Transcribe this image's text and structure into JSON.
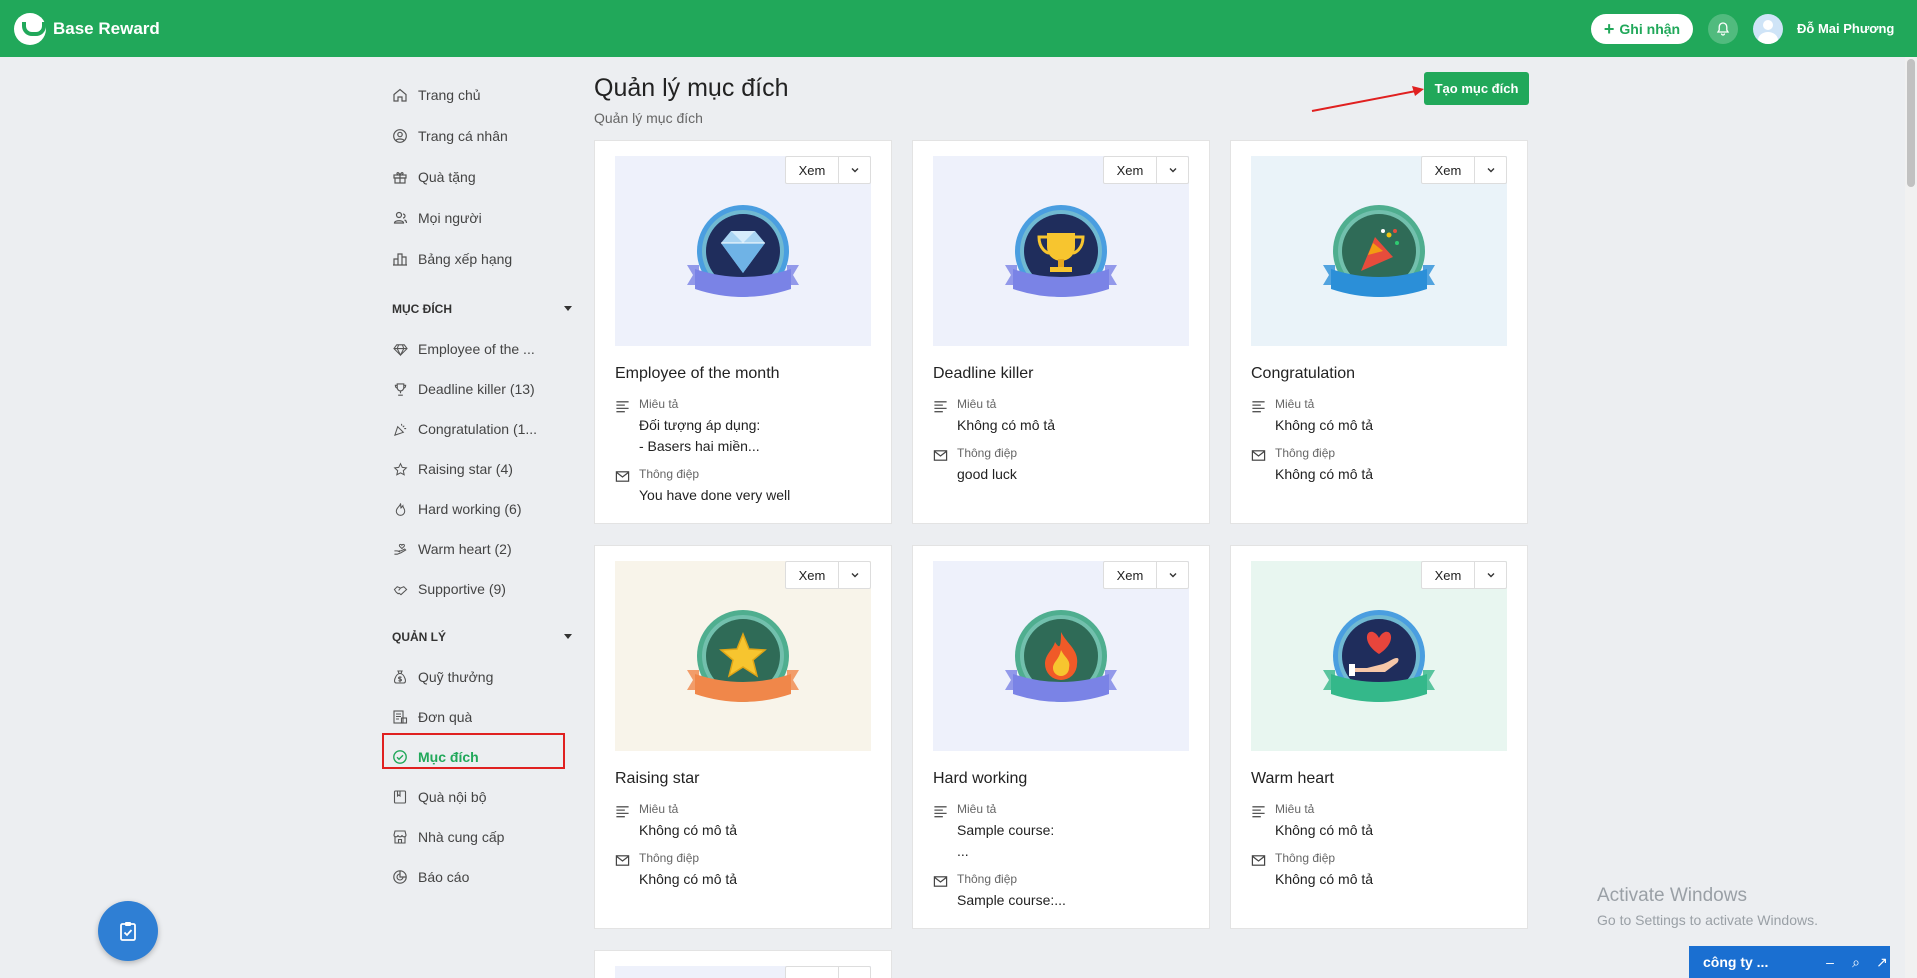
{
  "app": {
    "brand": "Base Reward",
    "record_button": "Ghi nhận",
    "user_name": "Đỗ Mai Phương",
    "accent": "#21a85a"
  },
  "sidebar": {
    "main": [
      {
        "label": "Trang chủ",
        "icon": "home-icon"
      },
      {
        "label": "Trang cá nhân",
        "icon": "profile-icon"
      },
      {
        "label": "Quà tặng",
        "icon": "gift-icon"
      },
      {
        "label": "Mọi người",
        "icon": "people-icon"
      },
      {
        "label": "Bảng xếp hạng",
        "icon": "leaderboard-icon"
      }
    ],
    "purpose_section": "MỤC ĐÍCH",
    "purposes": [
      {
        "label": "Employee of the ...",
        "icon": "diamond-icon"
      },
      {
        "label": "Deadline killer (13)",
        "icon": "trophy-icon"
      },
      {
        "label": "Congratulation (1...",
        "icon": "party-icon"
      },
      {
        "label": "Raising star (4)",
        "icon": "star-icon"
      },
      {
        "label": "Hard working (6)",
        "icon": "fire-icon"
      },
      {
        "label": "Warm heart (2)",
        "icon": "hand-heart-icon"
      },
      {
        "label": "Supportive (9)",
        "icon": "handshake-icon"
      }
    ],
    "manage_section": "QUẢN LÝ",
    "manage": [
      {
        "label": "Quỹ thưởng",
        "icon": "fund-icon"
      },
      {
        "label": "Đơn quà",
        "icon": "order-icon"
      },
      {
        "label": "Mục đích",
        "icon": "check-circle-icon",
        "active": true
      },
      {
        "label": "Quà nội bộ",
        "icon": "internal-gift-icon"
      },
      {
        "label": "Nhà cung cấp",
        "icon": "store-icon"
      },
      {
        "label": "Báo cáo",
        "icon": "report-icon"
      }
    ]
  },
  "page": {
    "title": "Quản lý mục đích",
    "subtitle": "Quản lý mục đích",
    "create_button": "Tạo mục đích"
  },
  "labels": {
    "view": "Xem",
    "description": "Miêu tả",
    "message": "Thông điệp"
  },
  "cards": [
    {
      "title": "Employee of the month",
      "desc": [
        "Đối tượng áp dụng:",
        "- Basers hai miền..."
      ],
      "message": "You have done very well",
      "badge": "diamond-icon",
      "bg": "#eef1fb",
      "ribbon": "#7a83e6"
    },
    {
      "title": "Deadline killer",
      "desc": [
        "Không có mô tả"
      ],
      "message": "good luck",
      "badge": "trophy-icon",
      "bg": "#eef1fb",
      "ribbon": "#7a83e6"
    },
    {
      "title": "Congratulation",
      "desc": [
        "Không có mô tả"
      ],
      "message": "Không có mô tả",
      "badge": "party-icon",
      "bg": "#eaf3f9",
      "ribbon": "#2b8fd8"
    },
    {
      "title": "Raising star",
      "desc": [
        "Không có mô tả"
      ],
      "message": "Không có mô tả",
      "badge": "star-icon",
      "bg": "#f8f4ea",
      "ribbon": "#f0874a"
    },
    {
      "title": "Hard working",
      "desc": [
        "Sample course:",
        "..."
      ],
      "message": "Sample course:...",
      "badge": "fire-icon",
      "bg": "#eef1fb",
      "ribbon": "#7a83e6"
    },
    {
      "title": "Warm heart",
      "desc": [
        "Không có mô tả"
      ],
      "message": "Không có mô tả",
      "badge": "hand-heart-icon",
      "bg": "#e8f6f0",
      "ribbon": "#34b88a"
    }
  ],
  "windows": {
    "line1": "Activate Windows",
    "line2": "Go to Settings to activate Windows."
  },
  "chat": {
    "label": "công ty ..."
  }
}
